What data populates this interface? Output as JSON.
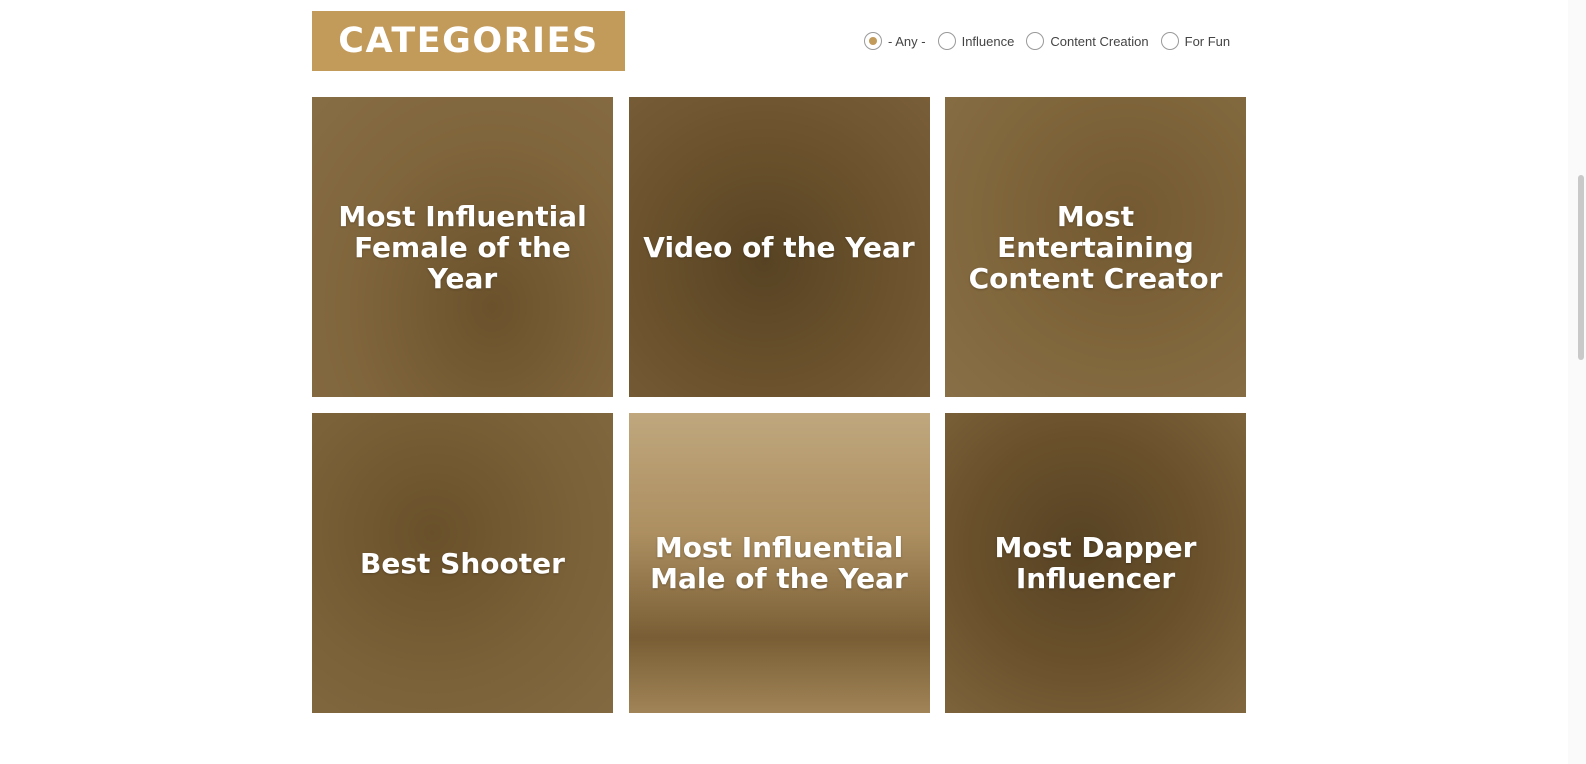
{
  "header": {
    "title": "CATEGORIES"
  },
  "filters": [
    {
      "label": "- Any -",
      "checked": true
    },
    {
      "label": "Influence",
      "checked": false
    },
    {
      "label": "Content Creation",
      "checked": false
    },
    {
      "label": "For Fun",
      "checked": false
    }
  ],
  "cards": [
    {
      "title": "Most Influential Female of the Year"
    },
    {
      "title": "Video of the Year"
    },
    {
      "title": "Most Entertaining Content Creator"
    },
    {
      "title": "Best Shooter"
    },
    {
      "title": "Most Influential Male of the Year"
    },
    {
      "title": "Most Dapper Influencer"
    }
  ],
  "colors": {
    "accent": "#c29a5a",
    "overlay": "#785c32"
  }
}
